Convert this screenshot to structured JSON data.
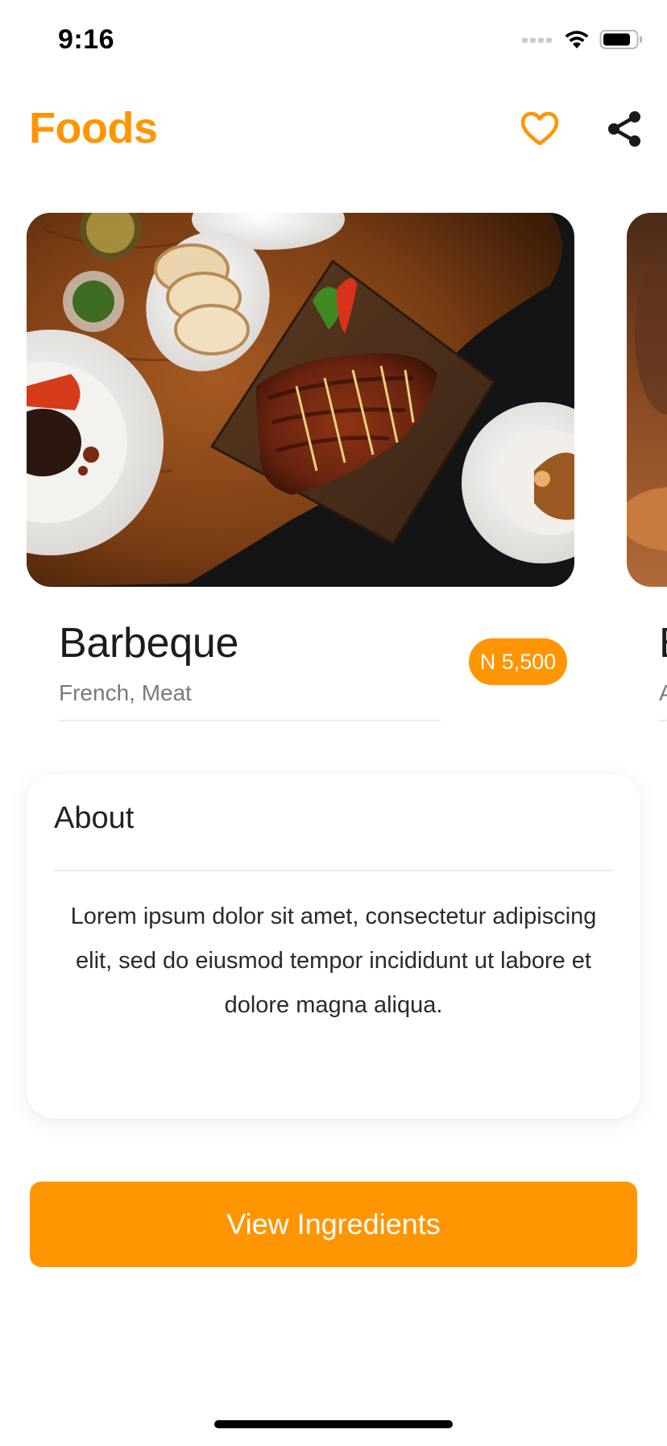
{
  "status_bar": {
    "time": "9:16",
    "signal_icon": "cellular-signal-icon",
    "wifi_icon": "wifi-icon",
    "battery_icon": "battery-icon"
  },
  "header": {
    "title": "Foods",
    "favorite_icon": "heart-outline-icon",
    "share_icon": "share-icon"
  },
  "colors": {
    "accent": "#FF9500",
    "text_primary": "#1c1c1c",
    "text_secondary": "#7a7a7a"
  },
  "foods": [
    {
      "name": "Barbeque",
      "tags": "French, Meat",
      "price": "N 5,500",
      "image": "barbeque-ribs-photo"
    },
    {
      "name": "B",
      "tags": "A",
      "image": "food-photo"
    }
  ],
  "about": {
    "title": "About",
    "text": "Lorem ipsum dolor sit amet, consectetur adipiscing elit, sed do eiusmod tempor incididunt ut labore et dolore magna aliqua."
  },
  "cta": {
    "label": "View Ingredients"
  }
}
